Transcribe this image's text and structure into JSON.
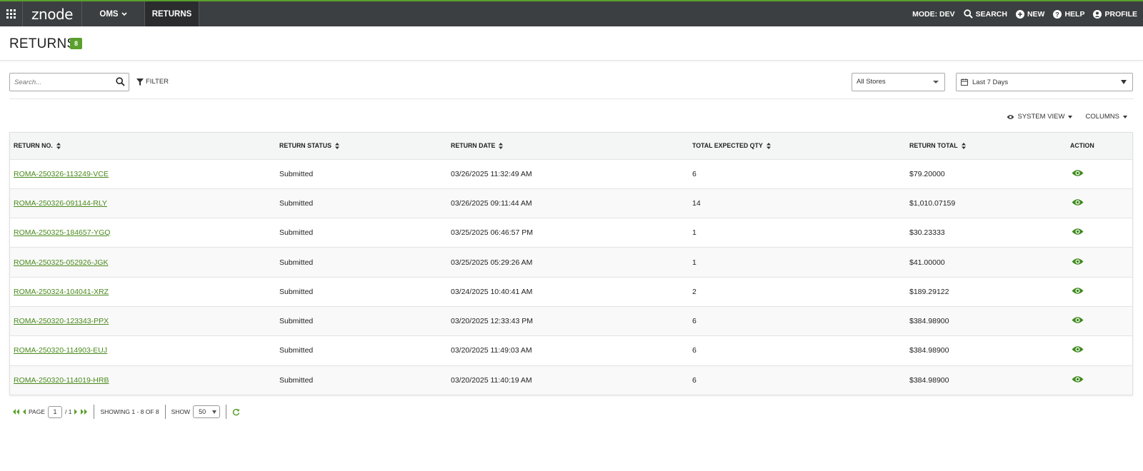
{
  "topbar": {
    "logo": "znode",
    "nav_oms": "OMS",
    "nav_returns": "RETURNS",
    "mode": "MODE: DEV",
    "search": "SEARCH",
    "new": "NEW",
    "help": "HELP",
    "profile": "PROFILE"
  },
  "header": {
    "title": "RETURNS",
    "count": "8"
  },
  "toolbar": {
    "search_placeholder": "Search...",
    "filter": "FILTER",
    "store": "All Stores",
    "date_range": "Last 7 Days",
    "system_view": "SYSTEM VIEW",
    "columns": "COLUMNS"
  },
  "table": {
    "headers": {
      "return_no": "RETURN NO.",
      "status": "RETURN STATUS",
      "date": "RETURN DATE",
      "qty": "TOTAL EXPECTED QTY",
      "total": "RETURN TOTAL",
      "action": "ACTION"
    },
    "rows": [
      {
        "no": "ROMA-250326-113249-VCE",
        "status": "Submitted",
        "date": "03/26/2025 11:32:49 AM",
        "qty": "6",
        "total": "$79.20000"
      },
      {
        "no": "ROMA-250326-091144-RLY",
        "status": "Submitted",
        "date": "03/26/2025 09:11:44 AM",
        "qty": "14",
        "total": "$1,010.07159"
      },
      {
        "no": "ROMA-250325-184657-YGQ",
        "status": "Submitted",
        "date": "03/25/2025 06:46:57 PM",
        "qty": "1",
        "total": "$30.23333"
      },
      {
        "no": "ROMA-250325-052926-JGK",
        "status": "Submitted",
        "date": "03/25/2025 05:29:26 AM",
        "qty": "1",
        "total": "$41.00000"
      },
      {
        "no": "ROMA-250324-104041-XRZ",
        "status": "Submitted",
        "date": "03/24/2025 10:40:41 AM",
        "qty": "2",
        "total": "$189.29122"
      },
      {
        "no": "ROMA-250320-123343-PPX",
        "status": "Submitted",
        "date": "03/20/2025 12:33:43 PM",
        "qty": "6",
        "total": "$384.98900"
      },
      {
        "no": "ROMA-250320-114903-EUJ",
        "status": "Submitted",
        "date": "03/20/2025 11:49:03 AM",
        "qty": "6",
        "total": "$384.98900"
      },
      {
        "no": "ROMA-250320-114019-HRB",
        "status": "Submitted",
        "date": "03/20/2025 11:40:19 AM",
        "qty": "6",
        "total": "$384.98900"
      }
    ]
  },
  "pager": {
    "page_label": "PAGE",
    "page": "1",
    "of_pages": "/ 1",
    "showing": "SHOWING 1 - 8 OF 8",
    "show_label": "SHOW",
    "page_size": "50"
  },
  "colors": {
    "accent": "#5aa02c",
    "topbar": "#3c3f41",
    "link": "#4a8a1c"
  }
}
